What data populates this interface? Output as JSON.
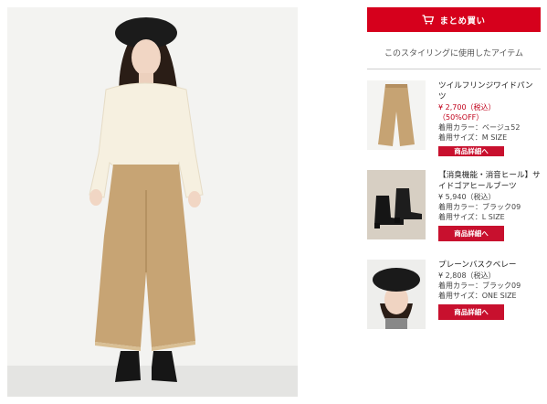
{
  "buy_button": {
    "label": "まとめ買い",
    "icon": "cart-icon"
  },
  "section_title": "このスタイリングに使用したアイテム",
  "colors": {
    "accent": "#d6001c",
    "price": "#c0001a"
  },
  "items": [
    {
      "name": "ツイルフリンジワイドパンツ",
      "price": "¥ 2,700（税込）",
      "discount": "（50%OFF）",
      "color_line": "着用カラー：ベージュ52",
      "size_line": "着用サイズ：M SIZE",
      "button": "商品詳細へ"
    },
    {
      "name": "【消臭機能・消音ヒール】サイドゴアヒールブーツ",
      "price": "¥ 5,940（税込）",
      "color_line": "着用カラー：ブラック09",
      "size_line": "着用サイズ：L SIZE",
      "button": "商品詳細へ"
    },
    {
      "name": "プレーンバスクベレー",
      "price": "¥ 2,808（税込）",
      "color_line": "着用カラー：ブラック09",
      "size_line": "着用サイズ：ONE SIZE",
      "button": "商品詳細へ"
    }
  ]
}
